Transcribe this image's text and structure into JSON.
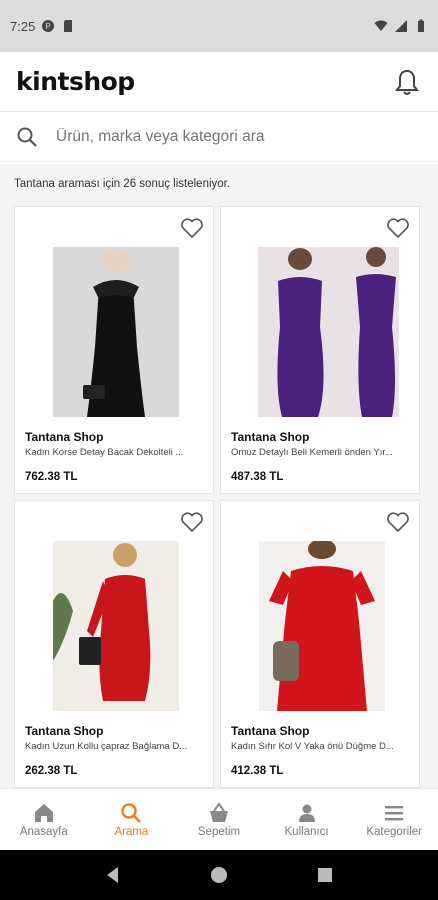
{
  "status_bar": {
    "time": "7:25"
  },
  "app": {
    "logo": "kintshop"
  },
  "search": {
    "placeholder": "Ürün, marka veya kategori ara"
  },
  "results": {
    "info": "Tantana araması için 26 sonuç listeleniyor."
  },
  "products": [
    {
      "brand": "Tantana Shop",
      "name": "Kadın Korse Detay Bacak Dekolteli ...",
      "price": "762.38 TL",
      "colors": [
        "#111111",
        "#d9d9d9"
      ]
    },
    {
      "brand": "Tantana Shop",
      "name": "Omuz Detaylı Beli Kemerli önden Yır...",
      "price": "487.38 TL",
      "colors": [
        "#4b2180",
        "#e8e2e4"
      ]
    },
    {
      "brand": "Tantana Shop",
      "name": "Kadın Uzun Kollu çapraz Bağlama D...",
      "price": "262.38 TL",
      "colors": [
        "#c8141b",
        "#f0ece6"
      ]
    },
    {
      "brand": "Tantana Shop",
      "name": "Kadın Sıfır Kol V Yaka önü Düğme D...",
      "price": "412.38 TL",
      "colors": [
        "#d0161c",
        "#f2f0ee"
      ]
    }
  ],
  "bottom_nav": [
    {
      "label": "Anasayfa",
      "icon": "home-icon",
      "active": false
    },
    {
      "label": "Arama",
      "icon": "search-icon",
      "active": true
    },
    {
      "label": "Sepetim",
      "icon": "basket-icon",
      "active": false
    },
    {
      "label": "Kullanıcı",
      "icon": "user-icon",
      "active": false
    },
    {
      "label": "Kategoriler",
      "icon": "menu-icon",
      "active": false
    }
  ],
  "theme": {
    "accent": "#f27a1a",
    "text": "#111111",
    "muted": "#7a7a7a",
    "background": "#f4f4f4"
  }
}
